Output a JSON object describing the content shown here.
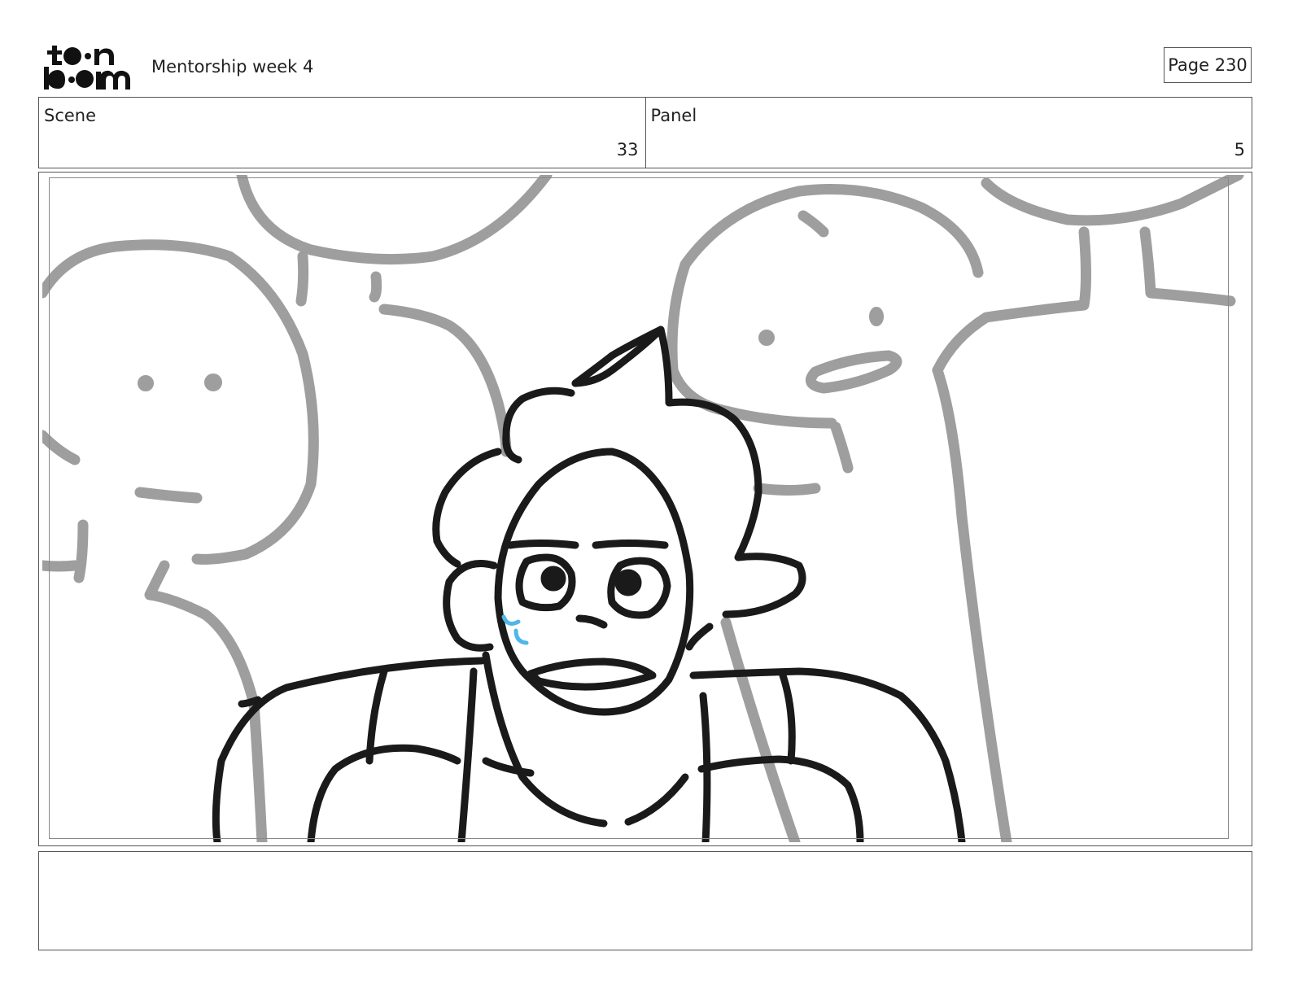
{
  "header": {
    "logo_text_top": "toon",
    "logo_text_bottom": "boom",
    "document_title": "Mentorship week 4",
    "page_label": "Page 230"
  },
  "info": {
    "scene_label": "Scene",
    "scene_value": "33",
    "panel_label": "Panel",
    "panel_value": "5"
  },
  "panel": {
    "image_name": "storyboard-sketch",
    "colors": {
      "line_art": "#1a1a1a",
      "background_figures": "#9e9e9e",
      "sweat_drops": "#4fb6ea"
    }
  },
  "notes": {
    "text": ""
  }
}
